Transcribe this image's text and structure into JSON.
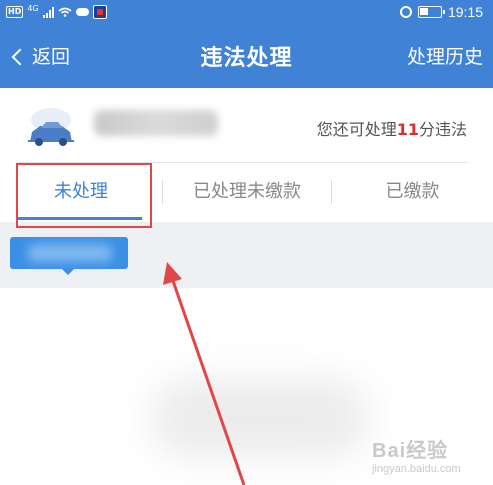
{
  "statusbar": {
    "hd_badge": "HD",
    "network": "4G",
    "time": "19:15"
  },
  "header": {
    "back_label": "返回",
    "title": "违法处理",
    "history_label": "处理历史"
  },
  "vehicle": {
    "remaining_prefix": "您还可处理",
    "remaining_count": "11",
    "remaining_suffix": "分违法"
  },
  "tabs": [
    {
      "label": "未处理",
      "active": true
    },
    {
      "label": "已处理未缴款",
      "active": false
    },
    {
      "label": "已缴款",
      "active": false
    }
  ],
  "colors": {
    "header_bg": "#3f82d6",
    "accent": "#3f82d6",
    "count_red": "#e02c2c",
    "annotation_red": "#e04848"
  },
  "watermark": {
    "main": "Bai经验",
    "sub": "jingyan.baidu.com"
  }
}
